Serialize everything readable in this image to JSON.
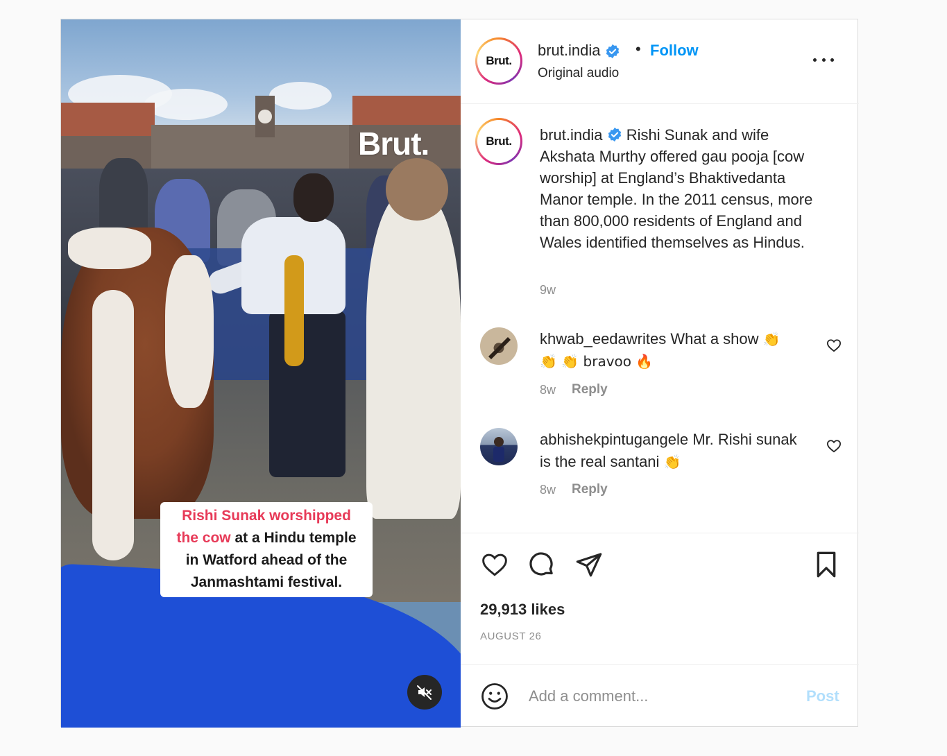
{
  "post": {
    "username": "brut.india",
    "avatar_text": "Brut.",
    "follow_label": "Follow",
    "separator": "•",
    "audio_label": "Original audio",
    "more_icon": "more-horizontal-icon"
  },
  "media": {
    "watermark": "Brut.",
    "caption_highlight": "Rishi Sunak worshipped the cow",
    "caption_line1": "Rishi Sunak worshipped",
    "caption_line2_hl": "the cow",
    "caption_line2_rest": " at a Hindu temple",
    "caption_line3": "in Watford ahead of the",
    "caption_line4": "Janmashtami festival.",
    "mute_icon": "muted-speaker-icon"
  },
  "caption": {
    "username": "brut.india",
    "text": "Rishi Sunak and wife Akshata Murthy offered gau pooja [cow worship] at England’s Bhaktivedanta Manor temple. In the 2011 census, more than 800,000 residents of England and Wales identified themselves as Hindus.",
    "time": "9w"
  },
  "comments": [
    {
      "username": "khwab_eedawrites",
      "text": "What a show ",
      "emoji_line": "👏 👏 bravoo 🔥",
      "emoji_inline": "👏",
      "time": "8w",
      "reply_label": "Reply"
    },
    {
      "username": "abhishekpintugangele",
      "text": "Mr. Rishi sunak is the real santani ",
      "emoji_inline": "👏",
      "time": "8w",
      "reply_label": "Reply"
    }
  ],
  "actions": {
    "like_icon": "heart-icon",
    "comment_icon": "comment-icon",
    "share_icon": "paper-plane-icon",
    "save_icon": "bookmark-icon"
  },
  "likes": "29,913 likes",
  "date": "AUGUST 26",
  "add_comment": {
    "placeholder": "Add a comment...",
    "post_label": "Post",
    "emoji_icon": "smiley-icon"
  },
  "colors": {
    "accent": "#0095f6",
    "post_disabled": "#b2dffc",
    "caption_highlight": "#e73a58",
    "muted_text": "#8e8e8e"
  }
}
